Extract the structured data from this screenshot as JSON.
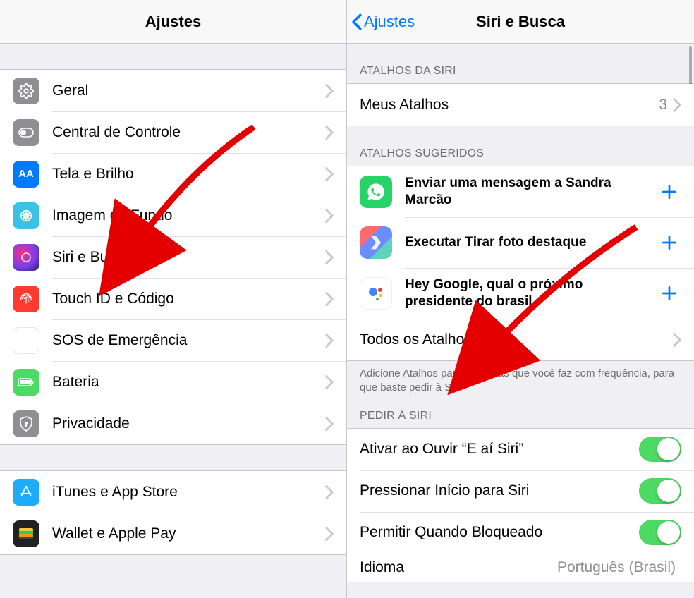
{
  "left": {
    "title": "Ajustes",
    "groups": [
      [
        {
          "id": "geral",
          "label": "Geral",
          "icon": "gear"
        },
        {
          "id": "control",
          "label": "Central de Controle",
          "icon": "control"
        },
        {
          "id": "display",
          "label": "Tela e Brilho",
          "icon": "display"
        },
        {
          "id": "wallpaper",
          "label": "Imagem de Fundo",
          "icon": "wallpaper"
        },
        {
          "id": "siri",
          "label": "Siri e Busca",
          "icon": "siri"
        },
        {
          "id": "touchid",
          "label": "Touch ID e Código",
          "icon": "touchid"
        },
        {
          "id": "sos",
          "label": "SOS de Emergência",
          "icon": "sos"
        },
        {
          "id": "battery",
          "label": "Bateria",
          "icon": "battery"
        },
        {
          "id": "privacy",
          "label": "Privacidade",
          "icon": "privacy"
        }
      ],
      [
        {
          "id": "appstore",
          "label": "iTunes e App Store",
          "icon": "appstore"
        },
        {
          "id": "wallet",
          "label": "Wallet e Apple Pay",
          "icon": "wallet"
        }
      ]
    ]
  },
  "right": {
    "back": "Ajustes",
    "title": "Siri e Busca",
    "section_shortcuts_header": "ATALHOS DA SIRI",
    "my_shortcuts_label": "Meus Atalhos",
    "my_shortcuts_count": "3",
    "section_suggested_header": "ATALHOS SUGERIDOS",
    "suggested": [
      {
        "id": "whatsapp",
        "label": "Enviar uma mensagem a Sandra Marcão",
        "icon": "whatsapp"
      },
      {
        "id": "shortcuts",
        "label": "Executar Tirar foto destaque",
        "icon": "shortcuts"
      },
      {
        "id": "ga",
        "label": "Hey Google, qual o próximo presidente do brasil",
        "icon": "ga"
      }
    ],
    "all_shortcuts_label": "Todos os Atalhos",
    "footer_text": "Adicione Atalhos para as coisas que você faz com frequência, para que baste pedir à Siri.",
    "section_ask_header": "PEDIR À SIRI",
    "toggles": [
      {
        "id": "hey",
        "label": "Ativar ao Ouvir “E aí Siri”",
        "on": true
      },
      {
        "id": "press",
        "label": "Pressionar Início para Siri",
        "on": true
      },
      {
        "id": "lock",
        "label": "Permitir Quando Bloqueado",
        "on": true
      }
    ],
    "language_label": "Idioma",
    "language_value": "Português (Brasil)"
  }
}
